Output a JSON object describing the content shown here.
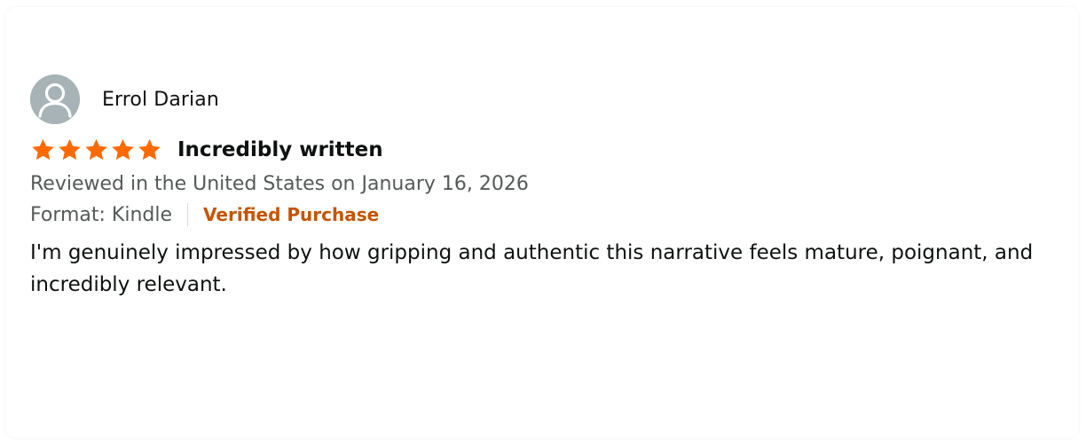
{
  "reviewer": {
    "name": "Errol Darian",
    "avatar_icon": "default-user-avatar-icon"
  },
  "rating": {
    "value": 5,
    "max": 5,
    "star_color": "#ff6a00"
  },
  "review": {
    "title": "Incredibly written",
    "date_line": "Reviewed in the United States on January 16, 2026",
    "format": "Format: Kindle",
    "verified": "Verified Purchase",
    "body": "I'm genuinely impressed by how gripping and authentic this narrative feels mature, poignant, and incredibly relevant."
  },
  "colors": {
    "verified": "#c45500",
    "secondary_text": "#565959",
    "avatar_bg": "#a7b3b6"
  }
}
